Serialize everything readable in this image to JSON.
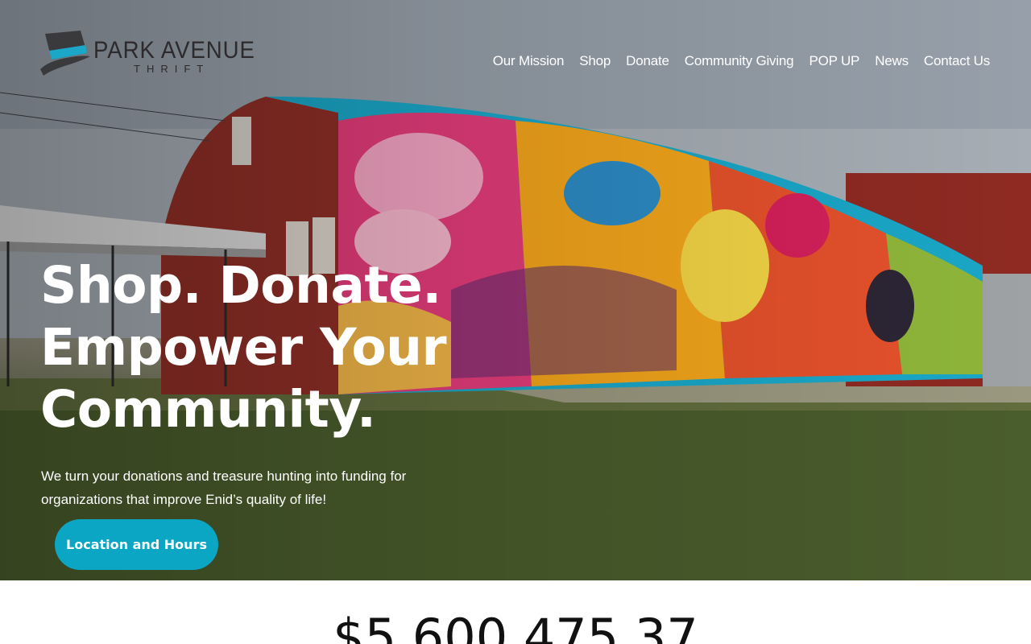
{
  "brand": {
    "name": "PARK AVENUE",
    "sub": "THRIFT",
    "hat_color": "#3a3a3c",
    "band_color": "#1aa7c8"
  },
  "nav": {
    "items": [
      {
        "label": "Our Mission"
      },
      {
        "label": "Shop"
      },
      {
        "label": "Donate"
      },
      {
        "label": "Community Giving"
      },
      {
        "label": "POP UP"
      },
      {
        "label": "News"
      },
      {
        "label": "Contact Us"
      }
    ]
  },
  "hero": {
    "headline": [
      "Shop. Donate.",
      "Empower Your",
      "Community."
    ],
    "subtitle": "We turn your donations and treasure hunting into funding for organizations that improve Enid’s quality of life!",
    "cta_label": "Location and Hours",
    "image_description": "colorful-mural-quonset-building"
  },
  "stats": {
    "total_raised": "$5,600,475.37"
  },
  "colors": {
    "accent": "#0ba6c3",
    "text_light": "#ffffff",
    "text_dark": "#111111"
  }
}
